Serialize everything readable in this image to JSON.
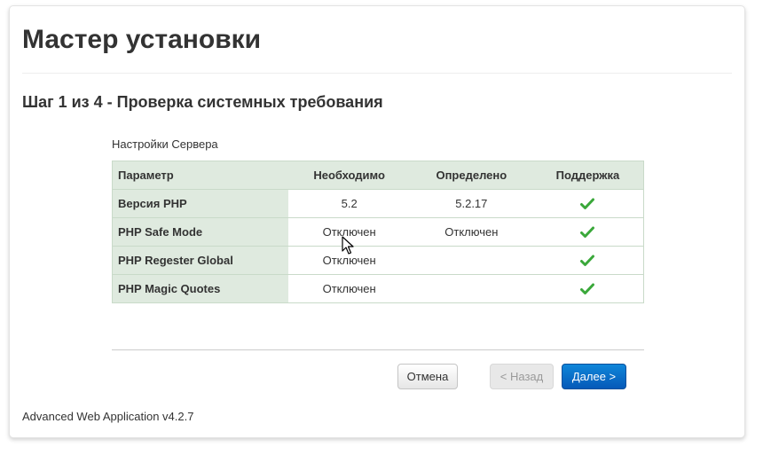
{
  "header": {
    "title": "Мастер установки",
    "step_title": "Шаг 1 из 4 - Проверка системных требования"
  },
  "server_settings": {
    "label": "Настройки Сервера",
    "columns": [
      "Параметр",
      "Необходимо",
      "Определено",
      "Поддержка"
    ],
    "rows": [
      {
        "param": "Версия PHP",
        "required": "5.2",
        "detected": "5.2.17",
        "supported": "check-icon"
      },
      {
        "param": "PHP Safe Mode",
        "required": "Отключен",
        "detected": "Отключен",
        "supported": "check-icon"
      },
      {
        "param": "PHP Regester Global",
        "required": "Отключен",
        "detected": "",
        "supported": "check-icon"
      },
      {
        "param": "PHP Magic Quotes",
        "required": "Отключен",
        "detected": "",
        "supported": "check-icon"
      }
    ]
  },
  "actions": {
    "cancel_label": "Отмена",
    "back_label": "< Назад",
    "next_label": "Далее >"
  },
  "footer": {
    "version_text": "Advanced Web Application v4.2.7"
  },
  "colors": {
    "header_bg": "#dfeadf",
    "check_green": "#3aa83a",
    "primary_button": "#0a6fd0"
  }
}
